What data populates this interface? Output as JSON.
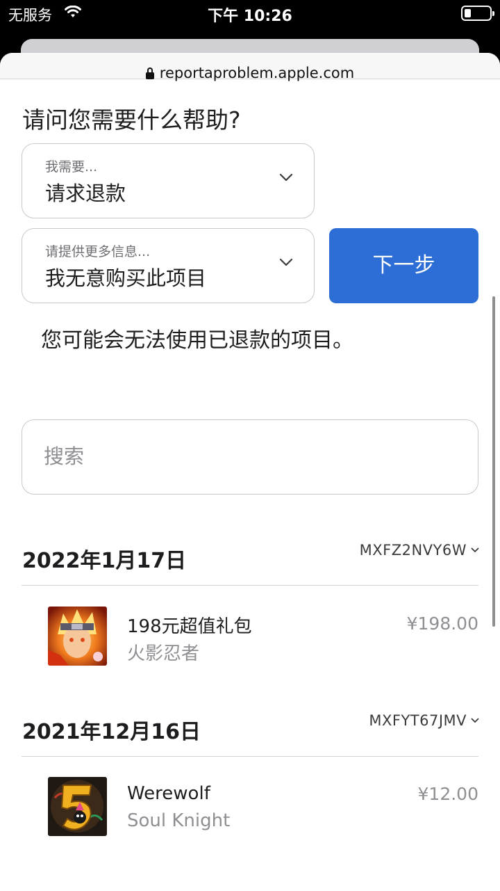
{
  "status_bar": {
    "carrier": "无服务",
    "time": "下午 10:26"
  },
  "browser": {
    "url": "reportaproblem.apple.com"
  },
  "help": {
    "heading": "请问您需要什么帮助?",
    "need_label": "我需要...",
    "need_value": "请求退款",
    "info_label": "请提供更多信息...",
    "info_value": "我无意购买此项目",
    "next_label": "下一步",
    "notice": "您可能会无法使用已退款的项目。"
  },
  "search": {
    "placeholder": "搜索"
  },
  "orders": [
    {
      "date": "2022年1月17日",
      "order_id": "MXFZ2NVY6W",
      "item": {
        "title": "198元超值礼包",
        "app": "火影忍者",
        "price": "¥198.00"
      }
    },
    {
      "date": "2021年12月16日",
      "order_id": "MXFYT67JMV",
      "item": {
        "title": "Werewolf",
        "app": "Soul Knight",
        "price": "¥12.00"
      }
    }
  ],
  "colors": {
    "accent": "#2c6ed5",
    "text": "#1d1d1f",
    "secondary_text": "#8e8e93",
    "border": "#c9c9cc"
  }
}
